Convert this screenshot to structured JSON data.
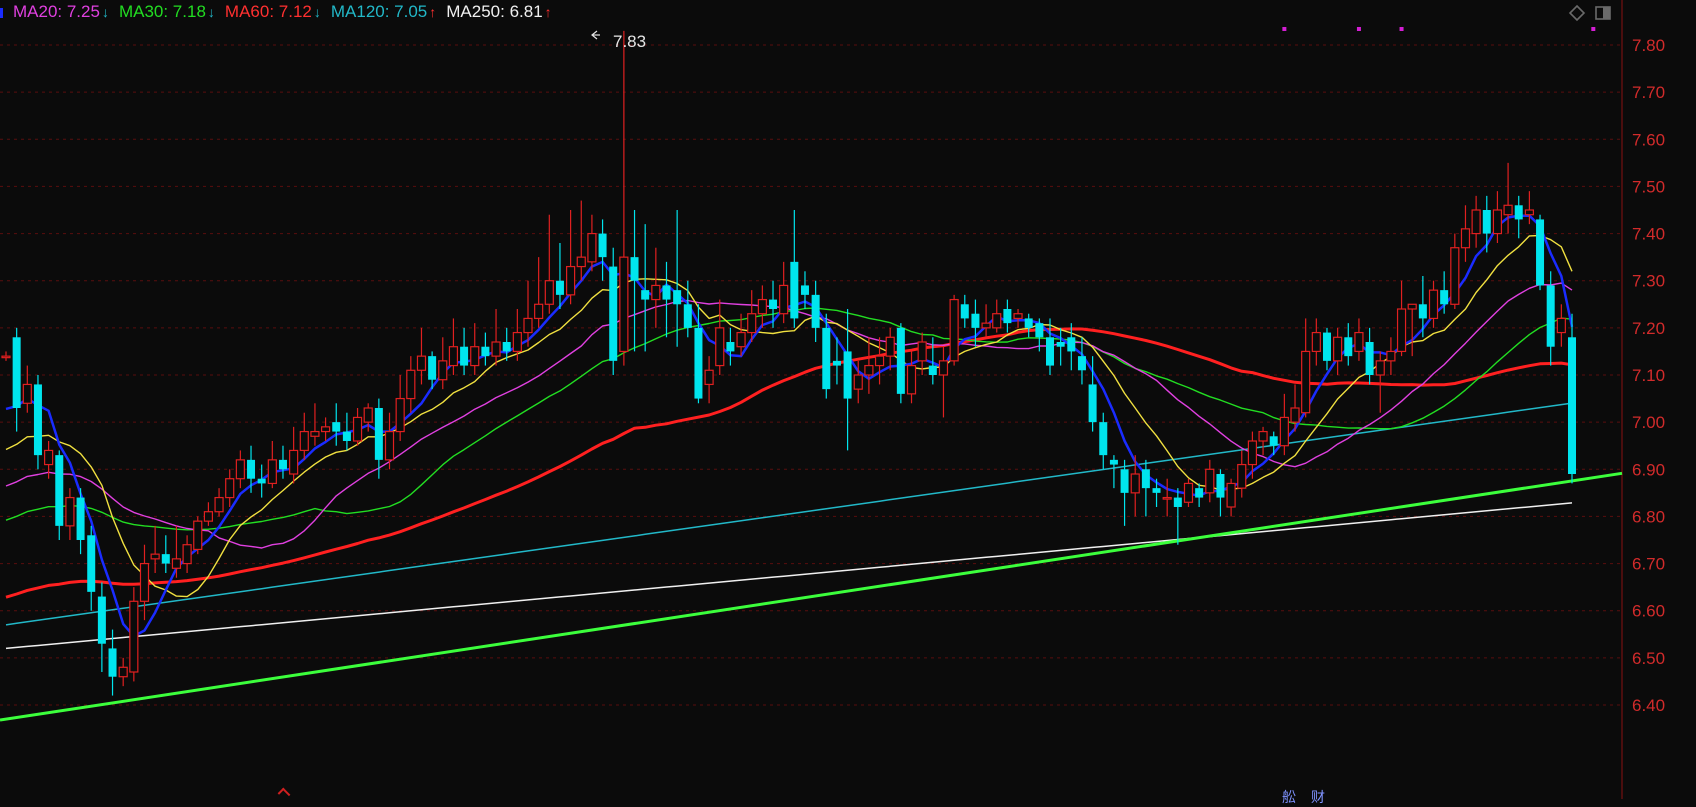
{
  "legend": {
    "items": [
      {
        "key": "MA20",
        "label": "MA20: 7.25",
        "arrow": "↓",
        "color": "#e040e0"
      },
      {
        "key": "MA30",
        "label": "MA30: 7.18",
        "arrow": "↓",
        "color": "#22dd22"
      },
      {
        "key": "MA60",
        "label": "MA60: 7.12",
        "arrow": "↓",
        "color": "#ff3030"
      },
      {
        "key": "MA120",
        "label": "MA120: 7.05",
        "arrow": "↑",
        "color": "#22b8c8"
      },
      {
        "key": "MA250",
        "label": "MA250: 6.81",
        "arrow": "↑",
        "color": "#f0f0f0"
      }
    ]
  },
  "toolbar": {
    "icons": [
      "diamond-icon",
      "panel-toggle-icon"
    ]
  },
  "footer": {
    "glyphs": [
      "舩",
      "财"
    ]
  },
  "chart_data": {
    "type": "candlestick",
    "ylim": [
      6.2,
      7.89
    ],
    "y_ticks": [
      "7.80",
      "7.70",
      "7.60",
      "7.50",
      "7.40",
      "7.30",
      "7.20",
      "7.10",
      "7.00",
      "6.90",
      "6.80",
      "6.70",
      "6.60",
      "6.50",
      "6.40"
    ],
    "grid": "dashed-horizontal",
    "peak_annotation": "7.83",
    "colors": {
      "up": "#e02020",
      "down": "#00e5ee",
      "ma5": "#1a2cff",
      "ma10": "#f0e040",
      "ma20": "#e040e0",
      "ma30": "#22dd22",
      "ma60": "#ff2020",
      "ma120": "#22b8c8",
      "ma250": "#f0f0f0",
      "trendline": "#3cff3c",
      "markers": "#d41ed4"
    },
    "trendline": [
      [
        0,
        6.37
      ],
      [
        160,
        6.92
      ]
    ],
    "candles": [
      [
        7.14,
        7.14,
        7.13,
        7.15
      ],
      [
        7.18,
        7.03,
        6.98,
        7.2
      ],
      [
        7.04,
        7.08,
        7.02,
        7.12
      ],
      [
        7.08,
        6.93,
        6.9,
        7.1
      ],
      [
        6.91,
        6.94,
        6.88,
        6.96
      ],
      [
        6.93,
        6.78,
        6.75,
        6.94
      ],
      [
        6.78,
        6.84,
        6.75,
        6.86
      ],
      [
        6.84,
        6.75,
        6.72,
        6.86
      ],
      [
        6.76,
        6.64,
        6.6,
        6.78
      ],
      [
        6.63,
        6.53,
        6.47,
        6.66
      ],
      [
        6.52,
        6.46,
        6.42,
        6.56
      ],
      [
        6.46,
        6.48,
        6.44,
        6.5
      ],
      [
        6.47,
        6.62,
        6.45,
        6.65
      ],
      [
        6.62,
        6.7,
        6.58,
        6.74
      ],
      [
        6.71,
        6.72,
        6.68,
        6.78
      ],
      [
        6.72,
        6.7,
        6.68,
        6.76
      ],
      [
        6.69,
        6.71,
        6.67,
        6.78
      ],
      [
        6.7,
        6.74,
        6.68,
        6.76
      ],
      [
        6.73,
        6.79,
        6.72,
        6.8
      ],
      [
        6.79,
        6.81,
        6.78,
        6.83
      ],
      [
        6.81,
        6.84,
        6.8,
        6.86
      ],
      [
        6.84,
        6.88,
        6.82,
        6.9
      ],
      [
        6.88,
        6.92,
        6.86,
        6.94
      ],
      [
        6.92,
        6.88,
        6.85,
        6.95
      ],
      [
        6.88,
        6.87,
        6.84,
        6.91
      ],
      [
        6.87,
        6.92,
        6.86,
        6.96
      ],
      [
        6.92,
        6.9,
        6.88,
        6.95
      ],
      [
        6.89,
        6.94,
        6.87,
        6.99
      ],
      [
        6.94,
        6.98,
        6.92,
        7.02
      ],
      [
        6.97,
        6.98,
        6.95,
        7.04
      ],
      [
        6.98,
        6.99,
        6.96,
        7.01
      ],
      [
        7.0,
        6.98,
        6.95,
        7.04
      ],
      [
        6.98,
        6.96,
        6.94,
        7.02
      ],
      [
        6.96,
        7.01,
        6.95,
        7.03
      ],
      [
        7.0,
        7.03,
        6.98,
        7.04
      ],
      [
        7.03,
        6.92,
        6.88,
        7.05
      ],
      [
        6.92,
        6.98,
        6.9,
        7.02
      ],
      [
        6.98,
        7.05,
        6.96,
        7.1
      ],
      [
        7.05,
        7.11,
        7.02,
        7.14
      ],
      [
        7.11,
        7.14,
        7.08,
        7.2
      ],
      [
        7.14,
        7.09,
        7.07,
        7.15
      ],
      [
        7.09,
        7.13,
        7.07,
        7.18
      ],
      [
        7.12,
        7.16,
        7.1,
        7.22
      ],
      [
        7.16,
        7.12,
        7.1,
        7.2
      ],
      [
        7.12,
        7.16,
        7.1,
        7.21
      ],
      [
        7.16,
        7.14,
        7.12,
        7.19
      ],
      [
        7.14,
        7.17,
        7.12,
        7.24
      ],
      [
        7.17,
        7.15,
        7.13,
        7.2
      ],
      [
        7.15,
        7.19,
        7.13,
        7.24
      ],
      [
        7.19,
        7.22,
        7.16,
        7.3
      ],
      [
        7.22,
        7.25,
        7.2,
        7.35
      ],
      [
        7.25,
        7.3,
        7.23,
        7.44
      ],
      [
        7.3,
        7.27,
        7.24,
        7.38
      ],
      [
        7.27,
        7.33,
        7.25,
        7.45
      ],
      [
        7.33,
        7.35,
        7.3,
        7.47
      ],
      [
        7.34,
        7.4,
        7.32,
        7.44
      ],
      [
        7.4,
        7.35,
        7.3,
        7.43
      ],
      [
        7.33,
        7.13,
        7.1,
        7.37
      ],
      [
        7.15,
        7.35,
        7.12,
        7.83
      ],
      [
        7.35,
        7.3,
        7.15,
        7.45
      ],
      [
        7.28,
        7.26,
        7.15,
        7.42
      ],
      [
        7.26,
        7.29,
        7.2,
        7.37
      ],
      [
        7.29,
        7.26,
        7.18,
        7.34
      ],
      [
        7.28,
        7.25,
        7.16,
        7.45
      ],
      [
        7.25,
        7.2,
        7.18,
        7.3
      ],
      [
        7.2,
        7.05,
        7.04,
        7.25
      ],
      [
        7.08,
        7.11,
        7.04,
        7.14
      ],
      [
        7.12,
        7.2,
        7.1,
        7.26
      ],
      [
        7.17,
        7.15,
        7.12,
        7.2
      ],
      [
        7.16,
        7.19,
        7.14,
        7.23
      ],
      [
        7.19,
        7.23,
        7.17,
        7.28
      ],
      [
        7.23,
        7.26,
        7.2,
        7.29
      ],
      [
        7.26,
        7.24,
        7.2,
        7.3
      ],
      [
        7.23,
        7.29,
        7.21,
        7.34
      ],
      [
        7.34,
        7.22,
        7.2,
        7.45
      ],
      [
        7.29,
        7.27,
        7.24,
        7.32
      ],
      [
        7.27,
        7.2,
        7.17,
        7.3
      ],
      [
        7.2,
        7.07,
        7.05,
        7.23
      ],
      [
        7.13,
        7.12,
        7.08,
        7.18
      ],
      [
        7.15,
        7.05,
        6.94,
        7.24
      ],
      [
        7.07,
        7.1,
        7.04,
        7.13
      ],
      [
        7.1,
        7.12,
        7.06,
        7.18
      ],
      [
        7.12,
        7.14,
        7.08,
        7.18
      ],
      [
        7.14,
        7.18,
        7.11,
        7.2
      ],
      [
        7.2,
        7.06,
        7.04,
        7.21
      ],
      [
        7.06,
        7.12,
        7.04,
        7.15
      ],
      [
        7.13,
        7.17,
        7.1,
        7.19
      ],
      [
        7.12,
        7.1,
        7.08,
        7.18
      ],
      [
        7.1,
        7.13,
        7.01,
        7.16
      ],
      [
        7.13,
        7.26,
        7.12,
        7.27
      ],
      [
        7.25,
        7.22,
        7.2,
        7.27
      ],
      [
        7.23,
        7.2,
        7.16,
        7.26
      ],
      [
        7.2,
        7.21,
        7.18,
        7.25
      ],
      [
        7.2,
        7.23,
        7.19,
        7.26
      ],
      [
        7.24,
        7.21,
        7.19,
        7.26
      ],
      [
        7.22,
        7.23,
        7.2,
        7.24
      ],
      [
        7.22,
        7.2,
        7.18,
        7.23
      ],
      [
        7.21,
        7.18,
        7.15,
        7.22
      ],
      [
        7.18,
        7.12,
        7.1,
        7.22
      ],
      [
        7.17,
        7.16,
        7.12,
        7.2
      ],
      [
        7.18,
        7.15,
        7.11,
        7.21
      ],
      [
        7.14,
        7.11,
        7.08,
        7.18
      ],
      [
        7.08,
        7.0,
        6.98,
        7.14
      ],
      [
        7.0,
        6.93,
        6.9,
        7.02
      ],
      [
        6.92,
        6.91,
        6.86,
        6.93
      ],
      [
        6.9,
        6.85,
        6.78,
        6.92
      ],
      [
        6.85,
        6.89,
        6.8,
        6.93
      ],
      [
        6.9,
        6.86,
        6.8,
        6.92
      ],
      [
        6.86,
        6.85,
        6.82,
        6.88
      ],
      [
        6.84,
        6.84,
        6.8,
        6.88
      ],
      [
        6.84,
        6.82,
        6.74,
        6.86
      ],
      [
        6.83,
        6.87,
        6.82,
        6.88
      ],
      [
        6.86,
        6.84,
        6.82,
        6.87
      ],
      [
        6.85,
        6.9,
        6.83,
        6.92
      ],
      [
        6.89,
        6.84,
        6.8,
        6.9
      ],
      [
        6.82,
        6.87,
        6.8,
        6.88
      ],
      [
        6.86,
        6.91,
        6.84,
        6.94
      ],
      [
        6.91,
        6.96,
        6.88,
        6.98
      ],
      [
        6.96,
        6.98,
        6.93,
        6.99
      ],
      [
        6.97,
        6.95,
        6.93,
        6.98
      ],
      [
        6.95,
        7.01,
        6.93,
        7.06
      ],
      [
        7.0,
        7.03,
        6.98,
        7.08
      ],
      [
        7.02,
        7.15,
        7.01,
        7.22
      ],
      [
        7.15,
        7.19,
        7.12,
        7.22
      ],
      [
        7.19,
        7.13,
        7.11,
        7.2
      ],
      [
        7.13,
        7.18,
        7.1,
        7.2
      ],
      [
        7.18,
        7.14,
        7.12,
        7.21
      ],
      [
        7.15,
        7.19,
        7.13,
        7.22
      ],
      [
        7.17,
        7.1,
        7.08,
        7.2
      ],
      [
        7.1,
        7.13,
        7.02,
        7.15
      ],
      [
        7.13,
        7.15,
        7.1,
        7.18
      ],
      [
        7.15,
        7.24,
        7.14,
        7.3
      ],
      [
        7.24,
        7.25,
        7.14,
        7.25
      ],
      [
        7.25,
        7.22,
        7.18,
        7.31
      ],
      [
        7.22,
        7.28,
        7.2,
        7.3
      ],
      [
        7.28,
        7.25,
        7.23,
        7.32
      ],
      [
        7.25,
        7.37,
        7.24,
        7.4
      ],
      [
        7.37,
        7.41,
        7.34,
        7.46
      ],
      [
        7.4,
        7.45,
        7.37,
        7.48
      ],
      [
        7.45,
        7.4,
        7.36,
        7.48
      ],
      [
        7.4,
        7.45,
        7.38,
        7.49
      ],
      [
        7.44,
        7.46,
        7.4,
        7.55
      ],
      [
        7.46,
        7.43,
        7.39,
        7.48
      ],
      [
        7.44,
        7.45,
        7.42,
        7.49
      ],
      [
        7.43,
        7.29,
        7.28,
        7.44
      ],
      [
        7.29,
        7.16,
        7.12,
        7.32
      ],
      [
        7.19,
        7.22,
        7.16,
        7.25
      ],
      [
        7.18,
        6.89,
        6.87,
        7.23
      ]
    ],
    "markers_x": [
      120,
      127,
      131,
      149
    ]
  }
}
